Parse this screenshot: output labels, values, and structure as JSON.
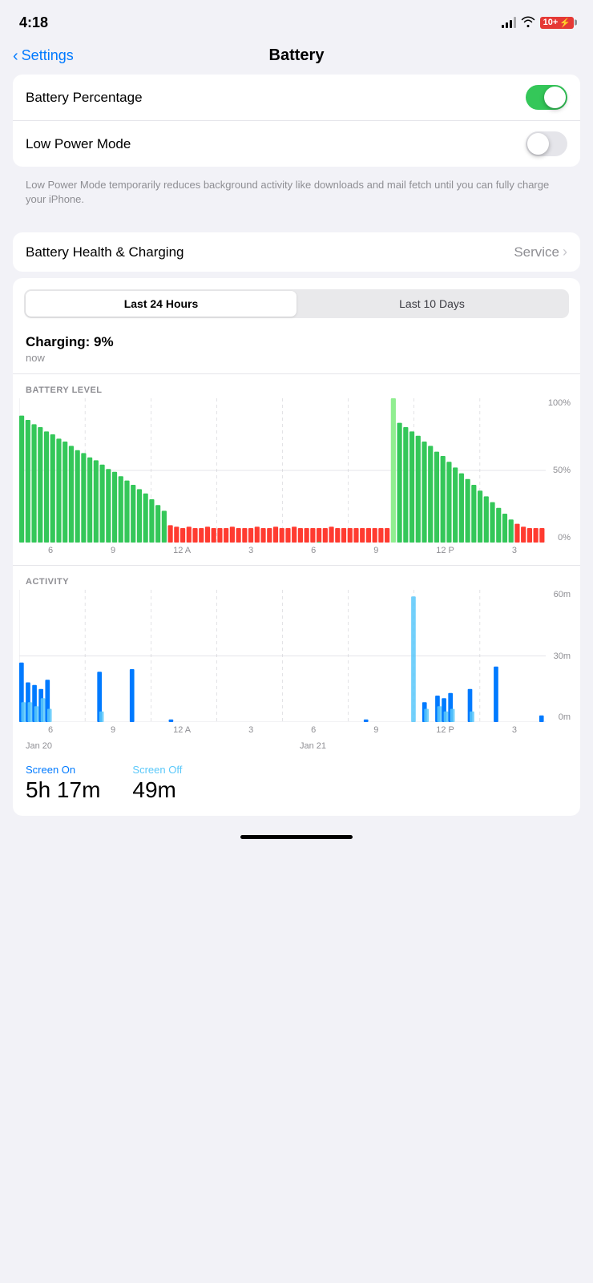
{
  "status_bar": {
    "time": "4:18",
    "battery_text": "10+"
  },
  "header": {
    "back_label": "Settings",
    "title": "Battery"
  },
  "toggles": {
    "battery_percentage": {
      "label": "Battery Percentage",
      "enabled": true
    },
    "low_power_mode": {
      "label": "Low Power Mode",
      "enabled": false,
      "description": "Low Power Mode temporarily reduces background activity like downloads and mail fetch until you can fully charge your iPhone."
    }
  },
  "battery_health": {
    "label": "Battery Health & Charging",
    "value": "Service"
  },
  "chart_section": {
    "tab_24h": "Last 24 Hours",
    "tab_10d": "Last 10 Days",
    "charging_title": "Charging: 9%",
    "charging_subtitle": "now",
    "battery_level_label": "BATTERY LEVEL",
    "activity_label": "ACTIVITY",
    "y_labels_battery": [
      "100%",
      "50%",
      "0%"
    ],
    "y_labels_activity": [
      "60m",
      "30m",
      "0m"
    ],
    "x_labels": [
      "6",
      "9",
      "12 A",
      "3",
      "6",
      "9",
      "12 P",
      "3"
    ],
    "x_labels_activity": [
      "6",
      "9",
      "12 A",
      "3",
      "6",
      "9",
      "12 P",
      "3"
    ],
    "date_labels": [
      "Jan 20",
      "Jan 21"
    ],
    "screen_on_label": "Screen On",
    "screen_on_value": "5h 17m",
    "screen_off_label": "Screen Off",
    "screen_off_value": "49m"
  }
}
